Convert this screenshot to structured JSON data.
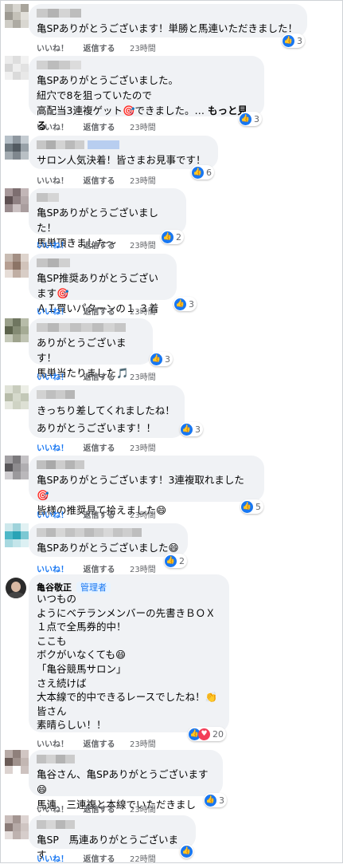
{
  "actions": {
    "like": "いいね！",
    "reply": "返信する"
  },
  "comments": [
    {
      "text": "亀SPありがとうございます！単勝と馬連いただきました！",
      "reactions": "3",
      "time": "23時間"
    },
    {
      "text": "亀SPありがとうございました。\n紐穴で8を狙っていたので\n高配当3連複ゲット🎯できました。…",
      "more": "もっと見る",
      "reactions": "3",
      "time": "23時間"
    },
    {
      "text": "サロン人気決着！皆さまお見事です！",
      "reactions": "6",
      "time": "23時間"
    },
    {
      "text": "亀SPありがとうございました！\n馬単頂きました～",
      "reactions": "2",
      "time": "23時間"
    },
    {
      "text": "亀SP推奨ありがとうございます🎯\nＡＩ買いパターンの１.３着😄",
      "reactions": "3",
      "time": "23時間"
    },
    {
      "text": "ありがとうございます！\n馬単当たりました🎵",
      "reactions": "3",
      "time": "23時間"
    },
    {
      "text": "きっちり差してくれましたね！\nありがとうございます！！",
      "reactions": "3",
      "time": "23時間"
    },
    {
      "text": "亀SPありがとうございます！3連複取れました🎯\n皆様の推奨見て拾えました😄",
      "reactions": "5",
      "time": "23時間"
    },
    {
      "text": "亀SPありがとうございました😄",
      "reactions": "2",
      "time": "23時間"
    },
    {
      "author": "亀谷敬正",
      "role": "管理者",
      "text": "いつもの\nようにベテランメンバーの先書きＢＯＸ\n１点で全馬券的中！\nここも\nボクがいなくても😄\n「亀谷競馬サロン」\nさえ続けば\n大本線で的中できるレースでしたね！👏\n皆さん\n素晴らしい！！",
      "reactions": "20",
      "time": "23時間"
    },
    {
      "text": "亀谷さん、亀SPありがとうございます😄\n馬連、三連複と本線でいただきました。",
      "reactions": "3",
      "time": "23時間"
    },
    {
      "text": "亀SP　馬連ありがとうございます",
      "reactions": "",
      "time": "22時間"
    }
  ]
}
